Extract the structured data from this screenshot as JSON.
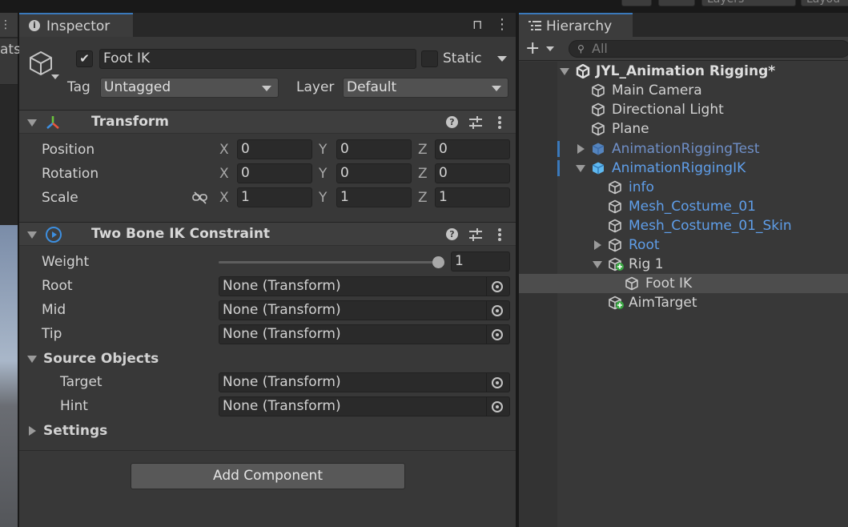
{
  "top_strip": {
    "layers_label": "Layers",
    "layout_label": "Layou"
  },
  "scene": {
    "tab_fragment": "ats"
  },
  "inspector": {
    "tab_label": "Inspector",
    "object": {
      "active": true,
      "name": "Foot IK",
      "static_label": "Static",
      "tag_label": "Tag",
      "tag_value": "Untagged",
      "layer_label": "Layer",
      "layer_value": "Default"
    },
    "transform": {
      "title": "Transform",
      "rows": [
        {
          "label": "Position",
          "x": "0",
          "y": "0",
          "z": "0"
        },
        {
          "label": "Rotation",
          "x": "0",
          "y": "0",
          "z": "0"
        },
        {
          "label": "Scale",
          "x": "1",
          "y": "1",
          "z": "1"
        }
      ],
      "axis_x": "X",
      "axis_y": "Y",
      "axis_z": "Z"
    },
    "two_bone": {
      "title": "Two Bone IK Constraint",
      "weight_label": "Weight",
      "weight_value": "1",
      "weight_fraction": 1.0,
      "root_label": "Root",
      "mid_label": "Mid",
      "tip_label": "Tip",
      "source_objects_label": "Source Objects",
      "target_label": "Target",
      "hint_label": "Hint",
      "settings_label": "Settings",
      "none_transform": "None (Transform)"
    },
    "add_component_label": "Add Component"
  },
  "hierarchy": {
    "tab_label": "Hierarchy",
    "search_placeholder": "All",
    "items": [
      {
        "label": "JYL_Animation Rigging*"
      },
      {
        "label": "Main Camera"
      },
      {
        "label": "Directional Light"
      },
      {
        "label": "Plane"
      },
      {
        "label": "AnimationRiggingTest"
      },
      {
        "label": "AnimationRiggingIK"
      },
      {
        "label": "info"
      },
      {
        "label": "Mesh_Costume_01"
      },
      {
        "label": "Mesh_Costume_01_Skin"
      },
      {
        "label": "Root"
      },
      {
        "label": "Rig 1"
      },
      {
        "label": "Foot IK"
      },
      {
        "label": "AimTarget"
      }
    ]
  },
  "colors": {
    "accent": "#3a79bb",
    "prefab_blue": "#5f9ee9",
    "panel": "#383838"
  }
}
